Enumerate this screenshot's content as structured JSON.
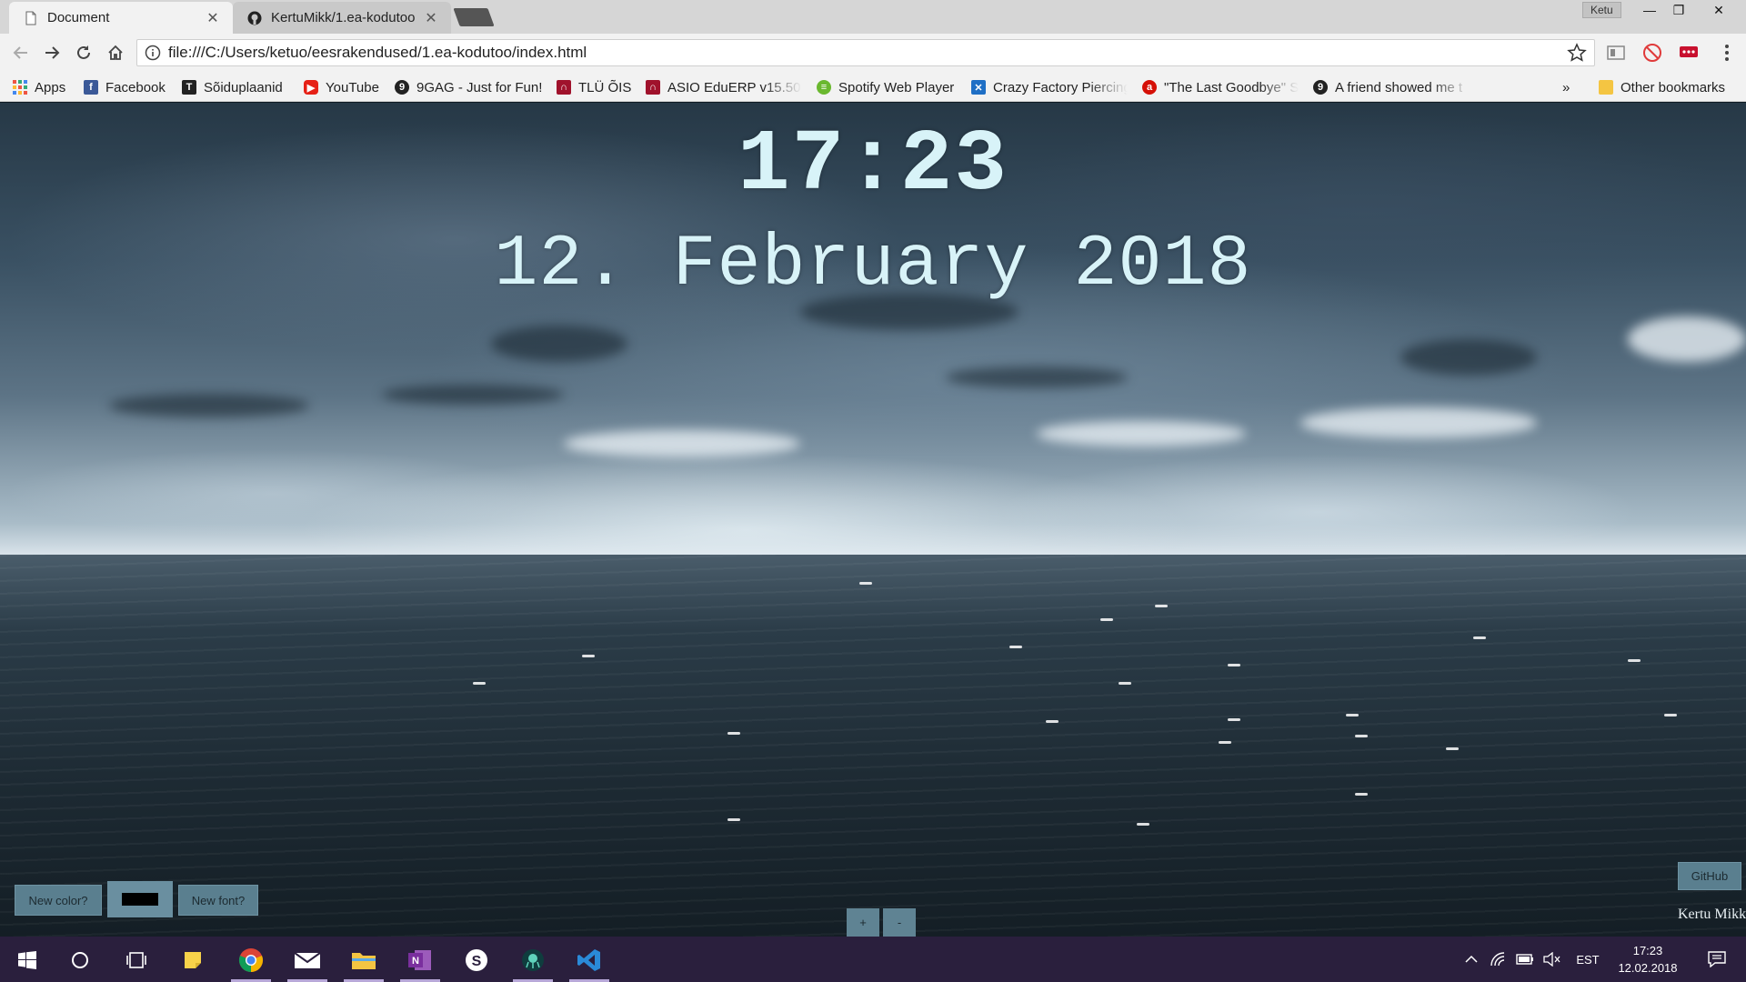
{
  "browser": {
    "tabs": [
      {
        "label": "Document",
        "active": true,
        "icon": "page-icon"
      },
      {
        "label": "KertuMikk/1.ea-kodutoo",
        "active": false,
        "icon": "github-icon"
      }
    ],
    "profile_name": "Ketu",
    "url": "file:///C:/Users/ketuo/eesrakendused/1.ea-kodutoo/index.html"
  },
  "bookmarks": {
    "items": [
      {
        "label": "Apps",
        "icon": "apps-grid-icon"
      },
      {
        "label": "Facebook",
        "icon": "facebook-icon"
      },
      {
        "label": "Sõiduplaanid",
        "icon": "tallinn-transport-icon"
      },
      {
        "label": "YouTube",
        "icon": "youtube-icon"
      },
      {
        "label": "9GAG - Just for Fun!",
        "icon": "9gag-icon"
      },
      {
        "label": "TLÜ ÕIS",
        "icon": "tlu-icon"
      },
      {
        "label": "ASIO EduERP v15.50",
        "icon": "tlu-icon"
      },
      {
        "label": "Spotify Web Player",
        "icon": "spotify-icon"
      },
      {
        "label": "Crazy Factory Piercing",
        "icon": "crazy-factory-icon"
      },
      {
        "label": "\"The Last Goodbye\" S",
        "icon": "lastfm-icon"
      },
      {
        "label": "A friend showed me t",
        "icon": "9gag-icon"
      }
    ],
    "overflow": "»",
    "other_label": "Other bookmarks"
  },
  "page": {
    "time": "17:23",
    "date": "12. February 2018",
    "new_color_label": "New color?",
    "current_color": "#000000",
    "new_font_label": "New font?",
    "plus_label": "+",
    "minus_label": "-",
    "github_label": "GitHub",
    "author": "Kertu Mikk"
  },
  "taskbar": {
    "apps": [
      "start-icon",
      "cortana-icon",
      "task-view-icon",
      "sticky-notes-icon",
      "chrome-icon",
      "mail-icon",
      "file-explorer-icon",
      "onenote-icon",
      "skype-icon",
      "gitkraken-icon",
      "vscode-icon"
    ],
    "language": "EST",
    "clock_time": "17:23",
    "clock_date": "12.02.2018"
  },
  "colors": {
    "clock_text": "#d8f3f8",
    "button_bg": "#5a7f8f",
    "taskbar_bg": "#2a1f3d"
  }
}
